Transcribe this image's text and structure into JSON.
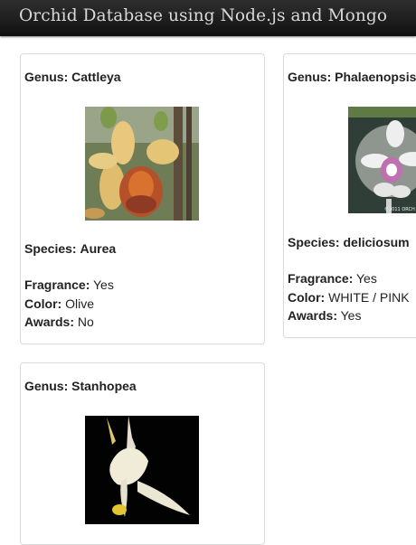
{
  "header": {
    "title": "Orchid Database using Node.js and Mongo"
  },
  "labels": {
    "genus": "Genus:",
    "species": "Species:",
    "fragrance": "Fragrance:",
    "color": "Color:",
    "awards": "Awards:"
  },
  "orchids": [
    {
      "genus": "Cattleya",
      "species": "Aurea",
      "fragrance": "Yes",
      "color": "Olive",
      "awards": "No"
    },
    {
      "genus": "Phalaenopsis",
      "species": "deliciosum",
      "fragrance": "Yes",
      "color": "WHITE / PINK",
      "awards": "Yes",
      "photo_credit": "©2011 ORCH"
    },
    {
      "genus": "Stanhopea"
    }
  ],
  "colors": {
    "navbar": "#1c1c1c",
    "title_text": "#d9d9d9",
    "card_border": "#dcdcdc"
  }
}
